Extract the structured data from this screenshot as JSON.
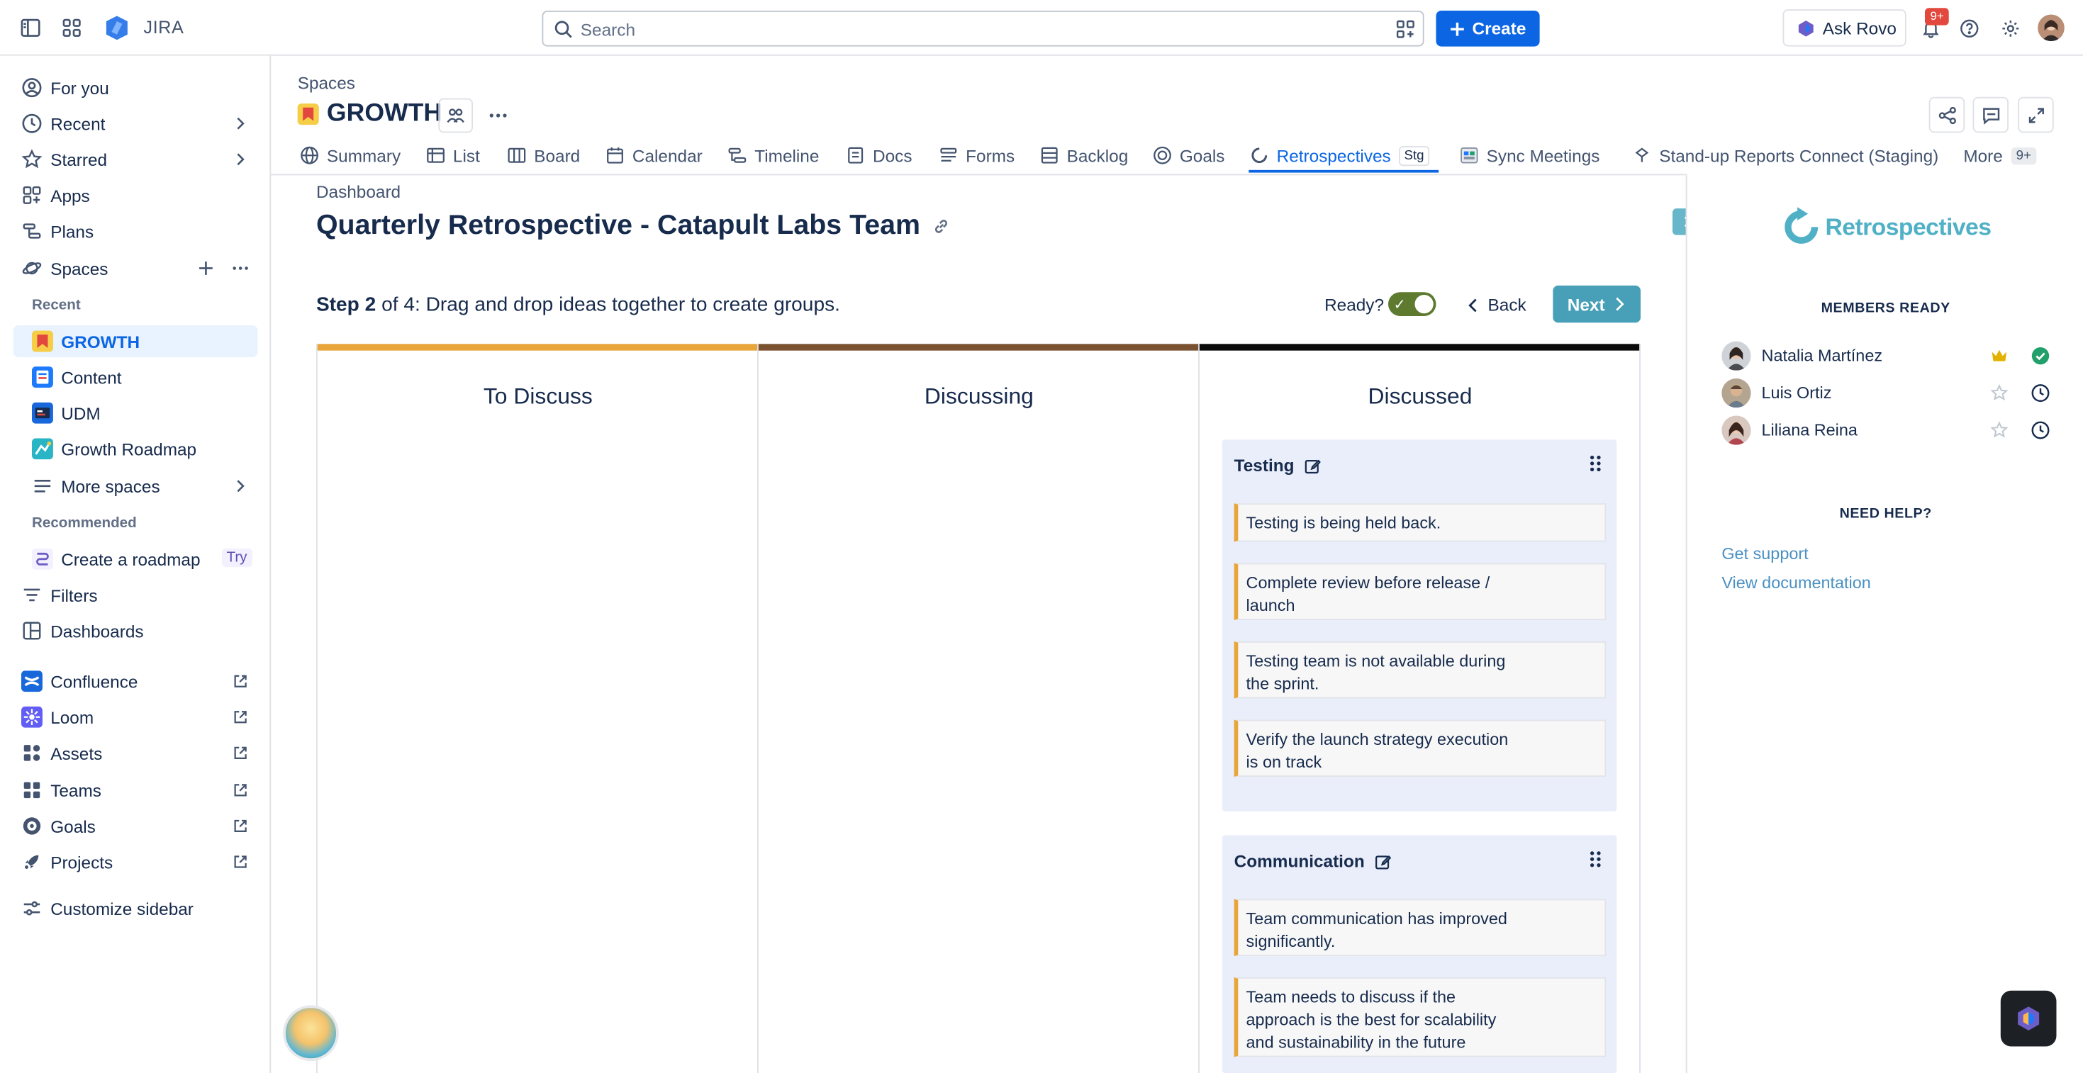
{
  "topbar": {
    "app_name": "JIRA",
    "search_placeholder": "Search",
    "create_label": "Create",
    "rovo_label": "Ask Rovo",
    "notification_badge": "9+"
  },
  "sidebar": {
    "items": [
      {
        "label": "For you",
        "icon": "person-circle-icon"
      },
      {
        "label": "Recent",
        "icon": "clock-icon"
      },
      {
        "label": "Starred",
        "icon": "star-icon"
      },
      {
        "label": "Apps",
        "icon": "apps-icon"
      },
      {
        "label": "Plans",
        "icon": "plans-icon"
      },
      {
        "label": "Spaces",
        "icon": "planet-icon"
      }
    ],
    "recent_heading": "Recent",
    "spaces": [
      {
        "label": "GROWTH",
        "color": "#f5cd47"
      },
      {
        "label": "Content",
        "color": "#1d7afc"
      },
      {
        "label": "UDM",
        "color": "#e2483d"
      },
      {
        "label": "Growth Roadmap",
        "color": "#2ab5c6"
      }
    ],
    "more_spaces": "More spaces",
    "recommended_heading": "Recommended",
    "create_roadmap": "Create a roadmap",
    "try_badge": "Try",
    "filters": "Filters",
    "dashboards": "Dashboards",
    "apps": [
      {
        "label": "Confluence",
        "color": "#1868db"
      },
      {
        "label": "Loom",
        "color": "#625df5"
      },
      {
        "label": "Assets",
        "color": "#44546f"
      },
      {
        "label": "Teams",
        "color": "#44546f"
      },
      {
        "label": "Goals",
        "color": "#44546f"
      },
      {
        "label": "Projects",
        "color": "#44546f"
      }
    ],
    "customize": "Customize sidebar"
  },
  "project": {
    "breadcrumb": "Spaces",
    "name": "GROWTH",
    "tabs": [
      {
        "label": "Summary",
        "icon": "globe-icon"
      },
      {
        "label": "List",
        "icon": "list-icon"
      },
      {
        "label": "Board",
        "icon": "board-icon"
      },
      {
        "label": "Calendar",
        "icon": "calendar-icon"
      },
      {
        "label": "Timeline",
        "icon": "timeline-icon"
      },
      {
        "label": "Docs",
        "icon": "docs-icon"
      },
      {
        "label": "Forms",
        "icon": "forms-icon"
      },
      {
        "label": "Backlog",
        "icon": "backlog-icon"
      },
      {
        "label": "Goals",
        "icon": "goals-icon"
      },
      {
        "label": "Retrospectives",
        "icon": "retro-icon",
        "badge": "Stg",
        "active": true
      },
      {
        "label": "Sync Meetings",
        "icon": "sync-meetings-icon"
      },
      {
        "label": "Stand-up Reports Connect (Staging)",
        "icon": "standup-icon"
      },
      {
        "label": "More",
        "icon": "",
        "badge": "9+"
      }
    ]
  },
  "retro": {
    "dashboard_link": "Dashboard",
    "title": "Quarterly Retrospective - Catapult Labs Team",
    "step_bold": "Step 2",
    "step_of": " of 4",
    "step_text": ": Drag and drop ideas together to create groups.",
    "ready_label": "Ready?",
    "back_label": "Back",
    "next_label": "Next",
    "columns": [
      {
        "title": "To Discuss",
        "color": "#e8a53a"
      },
      {
        "title": "Discussing",
        "color": "#7a5230"
      },
      {
        "title": "Discussed",
        "color": "#0b0b0b"
      }
    ],
    "groups": [
      {
        "title": "Testing",
        "cards": [
          "Testing is being held back.",
          "Complete review before release / launch",
          "Testing team is not available during the sprint.",
          "Verify the launch strategy execution is on track"
        ]
      },
      {
        "title": "Communication",
        "cards": [
          "Team communication has improved significantly.",
          "Team needs to discuss if the approach is the best for scalability and sustainability in the future"
        ]
      }
    ]
  },
  "panel": {
    "logo_text": "Retrospectives",
    "members_heading": "MEMBERS READY",
    "members": [
      {
        "name": "Natalia Martínez",
        "role": "facilitator",
        "status": "ready"
      },
      {
        "name": "Luis Ortiz",
        "role": "member",
        "status": "pending"
      },
      {
        "name": "Liliana Reina",
        "role": "member",
        "status": "pending"
      }
    ],
    "help_heading": "NEED HELP?",
    "support_link": "Get support",
    "docs_link": "View documentation"
  }
}
